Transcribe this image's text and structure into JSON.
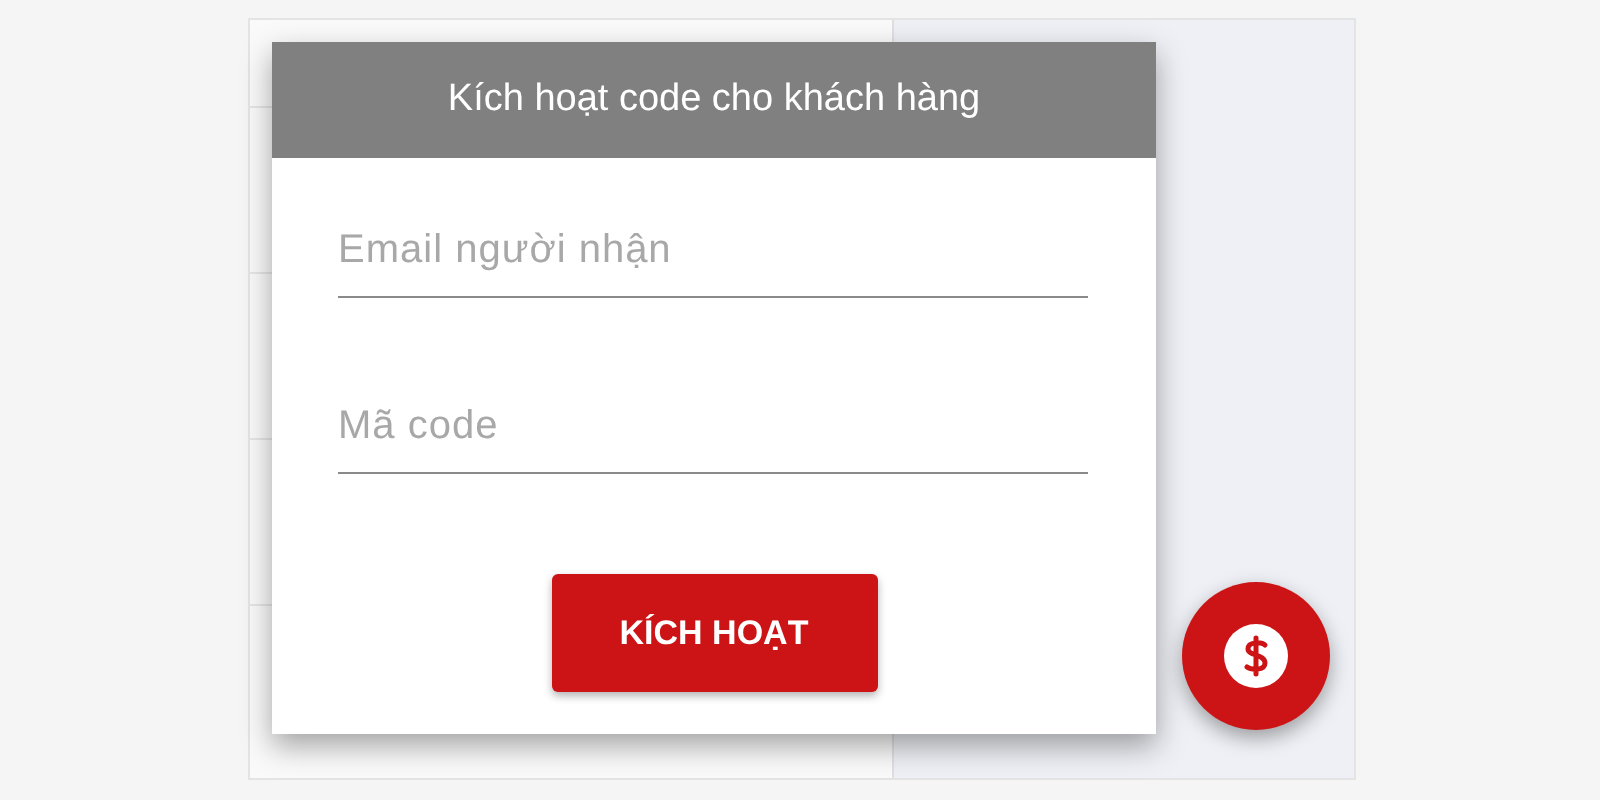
{
  "dialog": {
    "title": "Kích hoạt code cho khách hàng",
    "fields": [
      {
        "placeholder": "Email người nhận"
      },
      {
        "placeholder": "Mã code"
      }
    ],
    "button": "KÍCH HOẠT"
  }
}
